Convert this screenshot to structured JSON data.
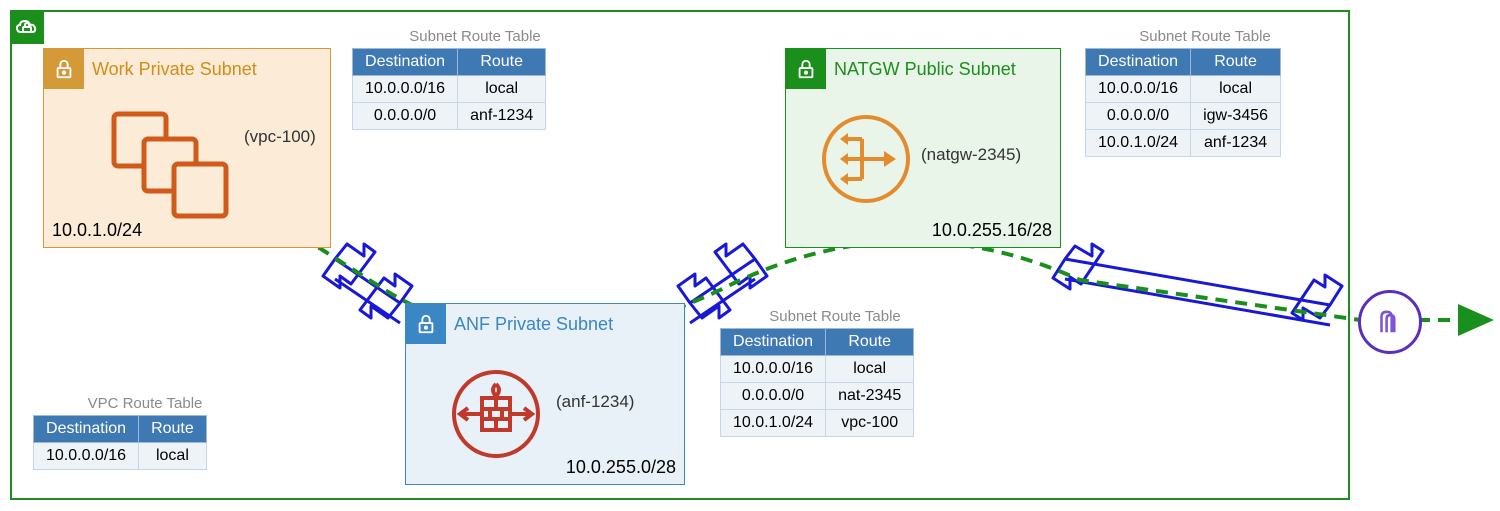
{
  "work": {
    "title": "Work Private Subnet",
    "cidr": "10.0.1.0/24",
    "note": "(vpc-100)"
  },
  "anf": {
    "title": "ANF Private Subnet",
    "cidr": "10.0.255.0/28",
    "note": "(anf-1234)"
  },
  "natgw": {
    "title": "NATGW Public Subnet",
    "cidr": "10.0.255.16/28",
    "note": "(natgw-2345)"
  },
  "rt_label": "Subnet Route Table",
  "vpc_rt_label": "VPC Route Table",
  "headers": {
    "dest": "Destination",
    "route": "Route"
  },
  "rt_work": [
    {
      "dest": "10.0.0.0/16",
      "route": "local"
    },
    {
      "dest": "0.0.0.0/0",
      "route": "anf-1234"
    }
  ],
  "rt_anf": [
    {
      "dest": "10.0.0.0/16",
      "route": "local"
    },
    {
      "dest": "0.0.0.0/0",
      "route": "nat-2345"
    },
    {
      "dest": "10.0.1.0/24",
      "route": "vpc-100"
    }
  ],
  "rt_natgw": [
    {
      "dest": "10.0.0.0/16",
      "route": "local"
    },
    {
      "dest": "0.0.0.0/0",
      "route": "igw-3456"
    },
    {
      "dest": "10.0.1.0/24",
      "route": "anf-1234"
    }
  ],
  "rt_vpc": [
    {
      "dest": "10.0.0.0/16",
      "route": "local"
    }
  ]
}
